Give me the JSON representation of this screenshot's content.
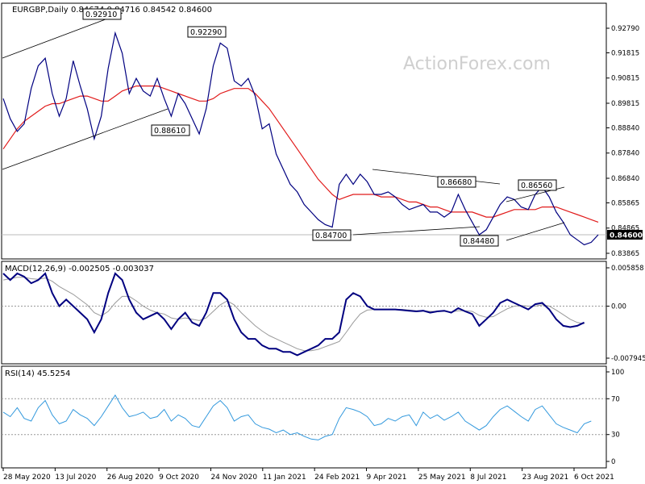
{
  "header": {
    "symbol": "EURGBP,Daily",
    "ohlc": "0.84674 0.84716 0.84542 0.84600",
    "watermark": "ActionForex.com"
  },
  "colors": {
    "price": "#000080",
    "ma": "#e11b1b",
    "macd": "#000080",
    "signal": "#9a9a9a",
    "rsi": "#3399dd",
    "trend": "#000000",
    "watermark": "#cfcfcf"
  },
  "chart_data": [
    {
      "type": "line",
      "name": "price",
      "ylim": [
        0.83865,
        0.9327
      ],
      "ticks": [
        "0.92790",
        "0.91815",
        "0.90815",
        "0.89815",
        "0.88840",
        "0.87840",
        "0.86840",
        "0.85865",
        "0.84865",
        "0.83865"
      ],
      "tick_values": [
        0.9279,
        0.91815,
        0.90815,
        0.89815,
        0.8884,
        0.8784,
        0.8684,
        0.85865,
        0.84865,
        0.83865
      ],
      "last_label": "0.84600",
      "last_value": 0.846,
      "series": [
        {
          "name": "EURGBP",
          "values": [
            0.9,
            0.892,
            0.887,
            0.89,
            0.904,
            0.913,
            0.916,
            0.902,
            0.893,
            0.9,
            0.915,
            0.905,
            0.896,
            0.884,
            0.893,
            0.912,
            0.926,
            0.918,
            0.902,
            0.908,
            0.903,
            0.901,
            0.908,
            0.9,
            0.893,
            0.902,
            0.898,
            0.892,
            0.886,
            0.896,
            0.913,
            0.922,
            0.92,
            0.907,
            0.905,
            0.908,
            0.901,
            0.888,
            0.89,
            0.878,
            0.872,
            0.866,
            0.863,
            0.858,
            0.855,
            0.852,
            0.85,
            0.849,
            0.866,
            0.87,
            0.866,
            0.87,
            0.867,
            0.862,
            0.862,
            0.863,
            0.861,
            0.858,
            0.856,
            0.857,
            0.858,
            0.855,
            0.855,
            0.853,
            0.855,
            0.862,
            0.856,
            0.851,
            0.846,
            0.848,
            0.853,
            0.858,
            0.861,
            0.86,
            0.857,
            0.856,
            0.862,
            0.865,
            0.861,
            0.855,
            0.851,
            0.846,
            0.844,
            0.842,
            0.843,
            0.846
          ]
        },
        {
          "name": "MA",
          "values": [
            0.88,
            0.884,
            0.888,
            0.891,
            0.893,
            0.895,
            0.897,
            0.898,
            0.898,
            0.899,
            0.9,
            0.901,
            0.901,
            0.9,
            0.899,
            0.899,
            0.901,
            0.903,
            0.904,
            0.905,
            0.905,
            0.905,
            0.905,
            0.904,
            0.903,
            0.902,
            0.901,
            0.9,
            0.899,
            0.899,
            0.9,
            0.902,
            0.903,
            0.904,
            0.904,
            0.904,
            0.902,
            0.899,
            0.896,
            0.892,
            0.888,
            0.884,
            0.88,
            0.876,
            0.872,
            0.868,
            0.865,
            0.862,
            0.86,
            0.861,
            0.862,
            0.862,
            0.862,
            0.862,
            0.861,
            0.861,
            0.861,
            0.86,
            0.859,
            0.859,
            0.858,
            0.857,
            0.857,
            0.856,
            0.855,
            0.855,
            0.855,
            0.855,
            0.854,
            0.853,
            0.853,
            0.854,
            0.855,
            0.856,
            0.856,
            0.856,
            0.856,
            0.857,
            0.857,
            0.857,
            0.856,
            0.855,
            0.854,
            0.853,
            0.852,
            0.851
          ]
        }
      ],
      "annotations": [
        {
          "label": "0.92910",
          "value": 0.9291
        },
        {
          "label": "0.92290",
          "value": 0.9229
        },
        {
          "label": "0.88610",
          "value": 0.8861
        },
        {
          "label": "0.84700",
          "value": 0.847
        },
        {
          "label": "0.86680",
          "value": 0.8668
        },
        {
          "label": "0.84480",
          "value": 0.8448
        },
        {
          "label": "0.86560",
          "value": 0.8656
        }
      ]
    },
    {
      "type": "line",
      "name": "macd",
      "title": "MACD(12,26,9) -0.002505 -0.003037",
      "ylim": [
        -0.007945,
        0.005858
      ],
      "ticks": [
        "0.005858",
        "0.00",
        "-0.007945"
      ],
      "tick_values": [
        0.005858,
        0.0,
        -0.007945
      ],
      "series": [
        {
          "name": "MACD",
          "values": [
            0.005,
            0.004,
            0.005,
            0.0045,
            0.0035,
            0.004,
            0.005,
            0.002,
            0.0,
            0.001,
            0.0,
            -0.001,
            -0.002,
            -0.004,
            -0.002,
            0.002,
            0.005,
            0.004,
            0.001,
            -0.001,
            -0.002,
            -0.0015,
            -0.001,
            -0.002,
            -0.0035,
            -0.002,
            -0.001,
            -0.0025,
            -0.003,
            -0.001,
            0.002,
            0.002,
            0.001,
            -0.002,
            -0.004,
            -0.005,
            -0.005,
            -0.006,
            -0.0065,
            -0.0065,
            -0.007,
            -0.007,
            -0.0075,
            -0.007,
            -0.0065,
            -0.006,
            -0.005,
            -0.005,
            -0.004,
            0.001,
            0.002,
            0.0015,
            0.0,
            -0.0005,
            -0.0005,
            -0.0005,
            -0.0005,
            -0.0006,
            -0.0007,
            -0.0008,
            -0.0007,
            -0.001,
            -0.0008,
            -0.0007,
            -0.001,
            -0.0003,
            -0.0008,
            -0.0012,
            -0.003,
            -0.002,
            -0.001,
            0.0005,
            0.001,
            0.0005,
            0.0,
            -0.0005,
            0.0003,
            0.0005,
            -0.0005,
            -0.002,
            -0.003,
            -0.0032,
            -0.003,
            -0.0025
          ]
        },
        {
          "name": "Signal",
          "values": [
            0.004,
            0.0042,
            0.0044,
            0.0044,
            0.0042,
            0.0041,
            0.0043,
            0.0038,
            0.003,
            0.0024,
            0.0018,
            0.001,
            0.0002,
            -0.001,
            -0.0015,
            -0.0008,
            0.0005,
            0.0015,
            0.0015,
            0.0008,
            0.0,
            -0.0006,
            -0.001,
            -0.0012,
            -0.0018,
            -0.002,
            -0.0018,
            -0.002,
            -0.0022,
            -0.0018,
            -0.0008,
            0.0002,
            0.0008,
            0.0002,
            -0.001,
            -0.002,
            -0.003,
            -0.0038,
            -0.0045,
            -0.005,
            -0.0055,
            -0.006,
            -0.0065,
            -0.0068,
            -0.0068,
            -0.0066,
            -0.0062,
            -0.0058,
            -0.0054,
            -0.004,
            -0.0025,
            -0.0012,
            -0.0006,
            -0.0005,
            -0.0005,
            -0.0005,
            -0.0005,
            -0.0005,
            -0.0006,
            -0.0007,
            -0.0007,
            -0.0008,
            -0.0008,
            -0.0008,
            -0.0009,
            -0.0007,
            -0.0007,
            -0.0008,
            -0.0014,
            -0.0017,
            -0.0016,
            -0.001,
            -0.0004,
            0.0,
            0.0001,
            0.0,
            0.0,
            0.0002,
            0.0,
            -0.0006,
            -0.0013,
            -0.002,
            -0.0025,
            -0.0027
          ]
        }
      ]
    },
    {
      "type": "line",
      "name": "rsi",
      "title": "RSI(14) 45.5254",
      "ylim": [
        0,
        100
      ],
      "ticks": [
        "100",
        "70",
        "30",
        "0"
      ],
      "tick_values": [
        100,
        70,
        30,
        0
      ],
      "levels": [
        70,
        30
      ],
      "series": [
        {
          "name": "RSI",
          "values": [
            55,
            50,
            60,
            48,
            45,
            60,
            68,
            52,
            42,
            45,
            58,
            52,
            48,
            40,
            50,
            62,
            74,
            60,
            50,
            52,
            55,
            48,
            50,
            58,
            45,
            52,
            48,
            40,
            38,
            50,
            62,
            68,
            60,
            45,
            50,
            52,
            42,
            38,
            36,
            32,
            35,
            30,
            32,
            28,
            25,
            24,
            28,
            30,
            48,
            60,
            58,
            55,
            50,
            40,
            42,
            48,
            45,
            50,
            52,
            40,
            55,
            48,
            52,
            46,
            50,
            55,
            45,
            40,
            35,
            40,
            50,
            58,
            62,
            56,
            50,
            45,
            58,
            62,
            52,
            42,
            38,
            35,
            32,
            42,
            45
          ]
        }
      ]
    }
  ],
  "x_axis": {
    "labels": [
      "28 May 2020",
      "13 Jul 2020",
      "26 Aug 2020",
      "9 Oct 2020",
      "24 Nov 2020",
      "11 Jan 2021",
      "24 Feb 2021",
      "9 Apr 2021",
      "25 May 2021",
      "8 Jul 2021",
      "23 Aug 2021",
      "6 Oct 2021"
    ]
  }
}
